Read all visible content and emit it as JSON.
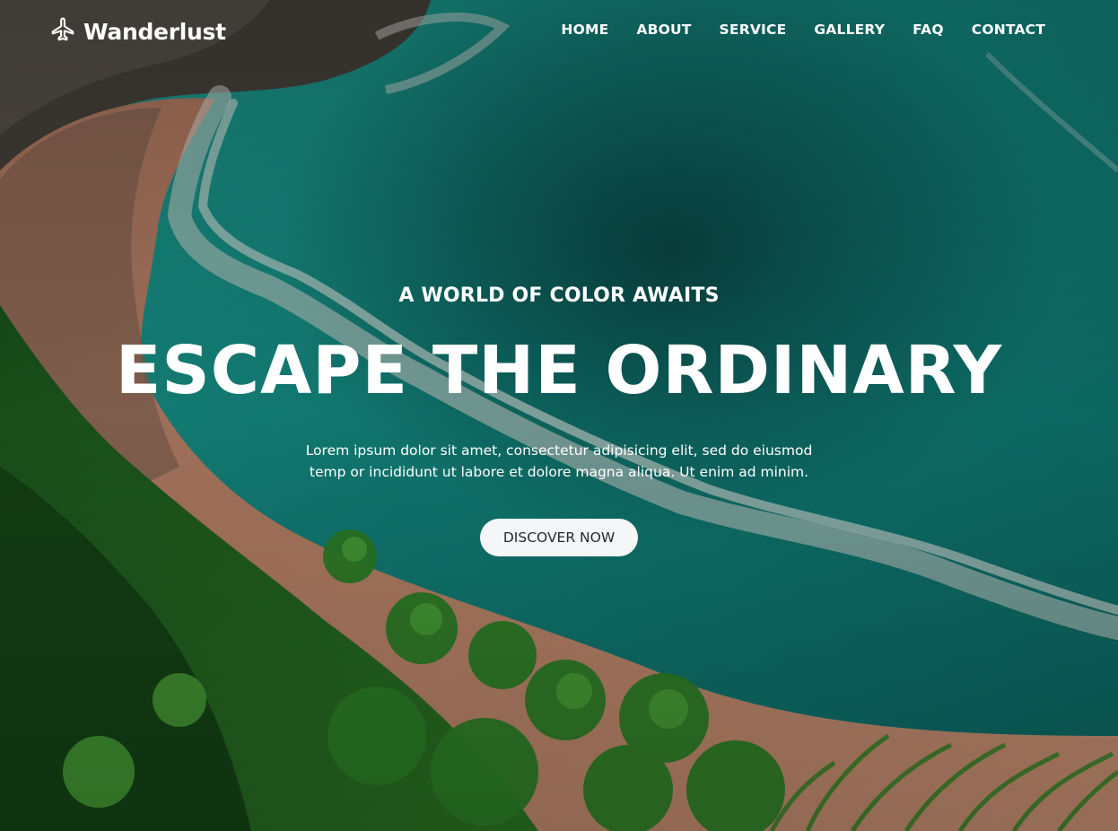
{
  "brand": {
    "name": "Wanderlust",
    "icon": "airplane-icon"
  },
  "nav": [
    {
      "label": "HOME"
    },
    {
      "label": "ABOUT"
    },
    {
      "label": "SERVICE"
    },
    {
      "label": "GALLERY"
    },
    {
      "label": "FAQ"
    },
    {
      "label": "CONTACT"
    }
  ],
  "hero": {
    "eyebrow": "A WORLD OF COLOR AWAITS",
    "headline": "ESCAPE THE ORDINARY",
    "lede": "Lorem ipsum dolor sit amet, consectetur adipisicing elit, sed do eiusmod temp or incididunt ut labore et dolore magna aliqua. Ut enim ad minim.",
    "cta": "DISCOVER NOW"
  },
  "colors": {
    "text": "#ffffff",
    "cta_bg": "#f5f6f7",
    "cta_text": "#1f2a30"
  }
}
